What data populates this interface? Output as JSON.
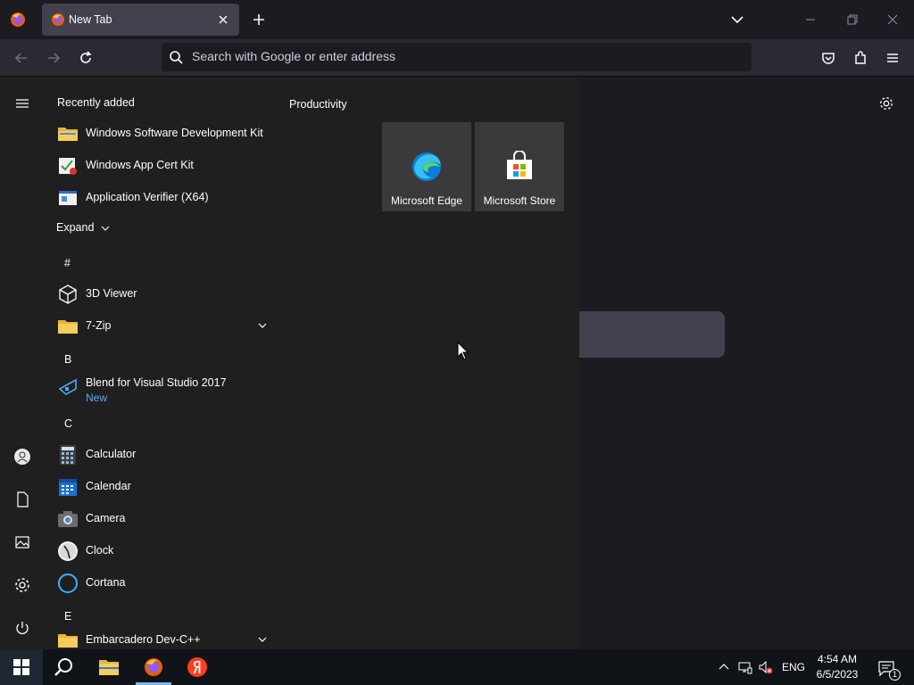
{
  "browser": {
    "tab_title": "New Tab",
    "url_placeholder": "Search with Google or enter address"
  },
  "start_menu": {
    "recently_added_header": "Recently added",
    "recent_apps": [
      {
        "label": "Windows Software Development Kit",
        "icon": "folder-icon"
      },
      {
        "label": "Windows App Cert Kit",
        "icon": "cert-kit-icon"
      },
      {
        "label": "Application Verifier (X64)",
        "icon": "app-verifier-icon"
      }
    ],
    "expand_label": "Expand",
    "sections": [
      {
        "letter": "#",
        "apps": [
          {
            "label": "3D Viewer",
            "icon": "cube-icon"
          },
          {
            "label": "7-Zip",
            "icon": "folder-icon",
            "expandable": true
          }
        ]
      },
      {
        "letter": "B",
        "apps": [
          {
            "label": "Blend for Visual Studio 2017",
            "sub": "New",
            "icon": "blend-icon"
          }
        ]
      },
      {
        "letter": "C",
        "apps": [
          {
            "label": "Calculator",
            "icon": "calculator-icon"
          },
          {
            "label": "Calendar",
            "icon": "calendar-icon"
          },
          {
            "label": "Camera",
            "icon": "camera-icon"
          },
          {
            "label": "Clock",
            "icon": "clock-icon"
          },
          {
            "label": "Cortana",
            "icon": "cortana-icon"
          }
        ]
      },
      {
        "letter": "E",
        "apps": [
          {
            "label": "Embarcadero Dev-C++",
            "icon": "folder-icon",
            "expandable": true
          }
        ]
      }
    ],
    "tiles_header": "Productivity",
    "tiles": [
      {
        "label": "Microsoft Edge",
        "icon": "edge-icon"
      },
      {
        "label": "Microsoft Store",
        "icon": "store-icon"
      }
    ]
  },
  "taskbar": {
    "language": "ENG",
    "time": "4:54 AM",
    "date": "6/5/2023",
    "notification_count": "1"
  },
  "colors": {
    "accent_link": "#5aa9ff",
    "startmenu_bg": "#1f1f1f",
    "tile_bg": "#3a3a3a",
    "browser_bg": "#1c1b22"
  }
}
